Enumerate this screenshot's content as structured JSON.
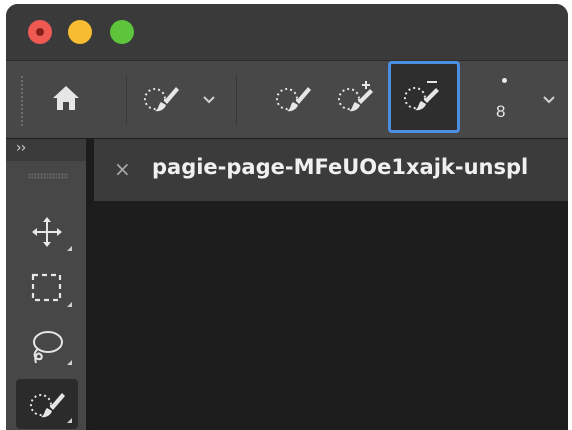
{
  "window": {
    "controls": [
      "close",
      "minimize",
      "zoom"
    ]
  },
  "options_bar": {
    "home_icon": "home-icon",
    "tool_preset_icon": "quick-selection-brush-icon",
    "modes": [
      {
        "icon": "new-selection-brush-icon"
      },
      {
        "icon": "add-to-selection-brush-icon"
      },
      {
        "icon": "subtract-from-selection-brush-icon",
        "active": true
      }
    ],
    "brush_size": "8"
  },
  "tool_panel": {
    "collapse_label": "››",
    "tools": [
      {
        "icon": "move-tool-icon"
      },
      {
        "icon": "rectangular-marquee-icon"
      },
      {
        "icon": "lasso-icon"
      },
      {
        "icon": "quick-selection-icon",
        "selected": true
      }
    ]
  },
  "document": {
    "close_symbol": "×",
    "tab_title": "pagie-page-MFeUOe1xajk-unspl"
  },
  "colors": {
    "accent_blue": "#4b8fe5",
    "close_red": "#ee5a52",
    "minimize_yellow": "#f5bd2f",
    "zoom_green": "#5dc43b"
  }
}
